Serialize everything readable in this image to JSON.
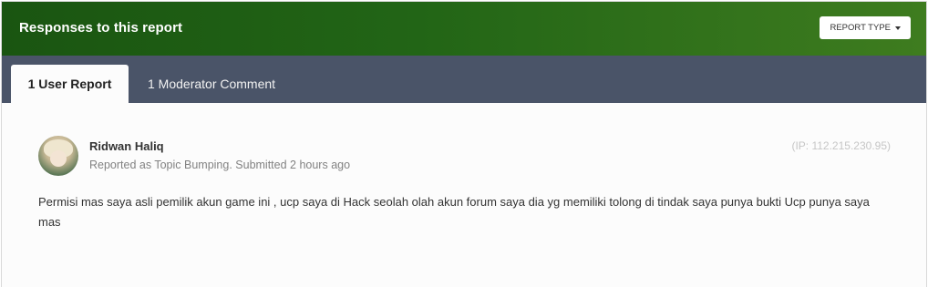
{
  "header": {
    "title": "Responses to this report",
    "report_type_label": "REPORT TYPE"
  },
  "tabs": [
    {
      "label": "1 User Report",
      "active": true
    },
    {
      "label": "1 Moderator Comment",
      "active": false
    }
  ],
  "report": {
    "username": "Ridwan Haliq",
    "meta": "Reported as Topic Bumping. Submitted 2 hours ago",
    "ip": "(IP: 112.215.230.95)",
    "body": "Permisi mas saya asli pemilik akun game ini , ucp saya di Hack seolah olah akun forum saya dia yg memiliki tolong di tindak saya punya bukti Ucp punya saya mas"
  },
  "colors": {
    "header_gradient_start": "#1a5511",
    "header_gradient_end": "#3e7c1f",
    "tab_bar": "#4a5468",
    "accent_text": "#333333"
  }
}
